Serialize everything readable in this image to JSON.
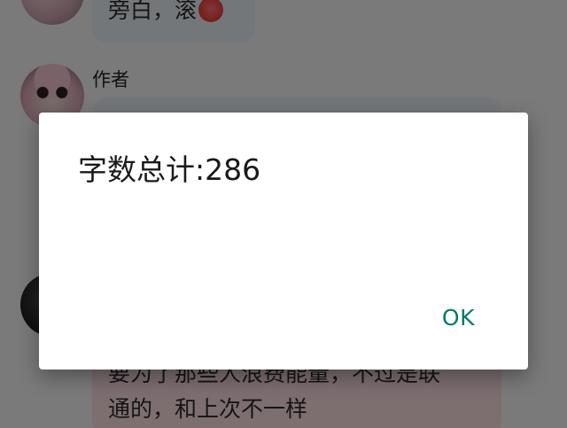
{
  "chat": {
    "message_1": {
      "text": "旁白，滚",
      "emoji": "angry-face"
    },
    "message_2": {
      "sender": "作者"
    },
    "message_3": {
      "line_1": "要为了那些人浪费能量，不过是联",
      "line_2": "通的，和上次不一样"
    }
  },
  "dialog": {
    "title": "字数总计:286",
    "ok_label": "OK",
    "ok_color": "#00796b"
  }
}
